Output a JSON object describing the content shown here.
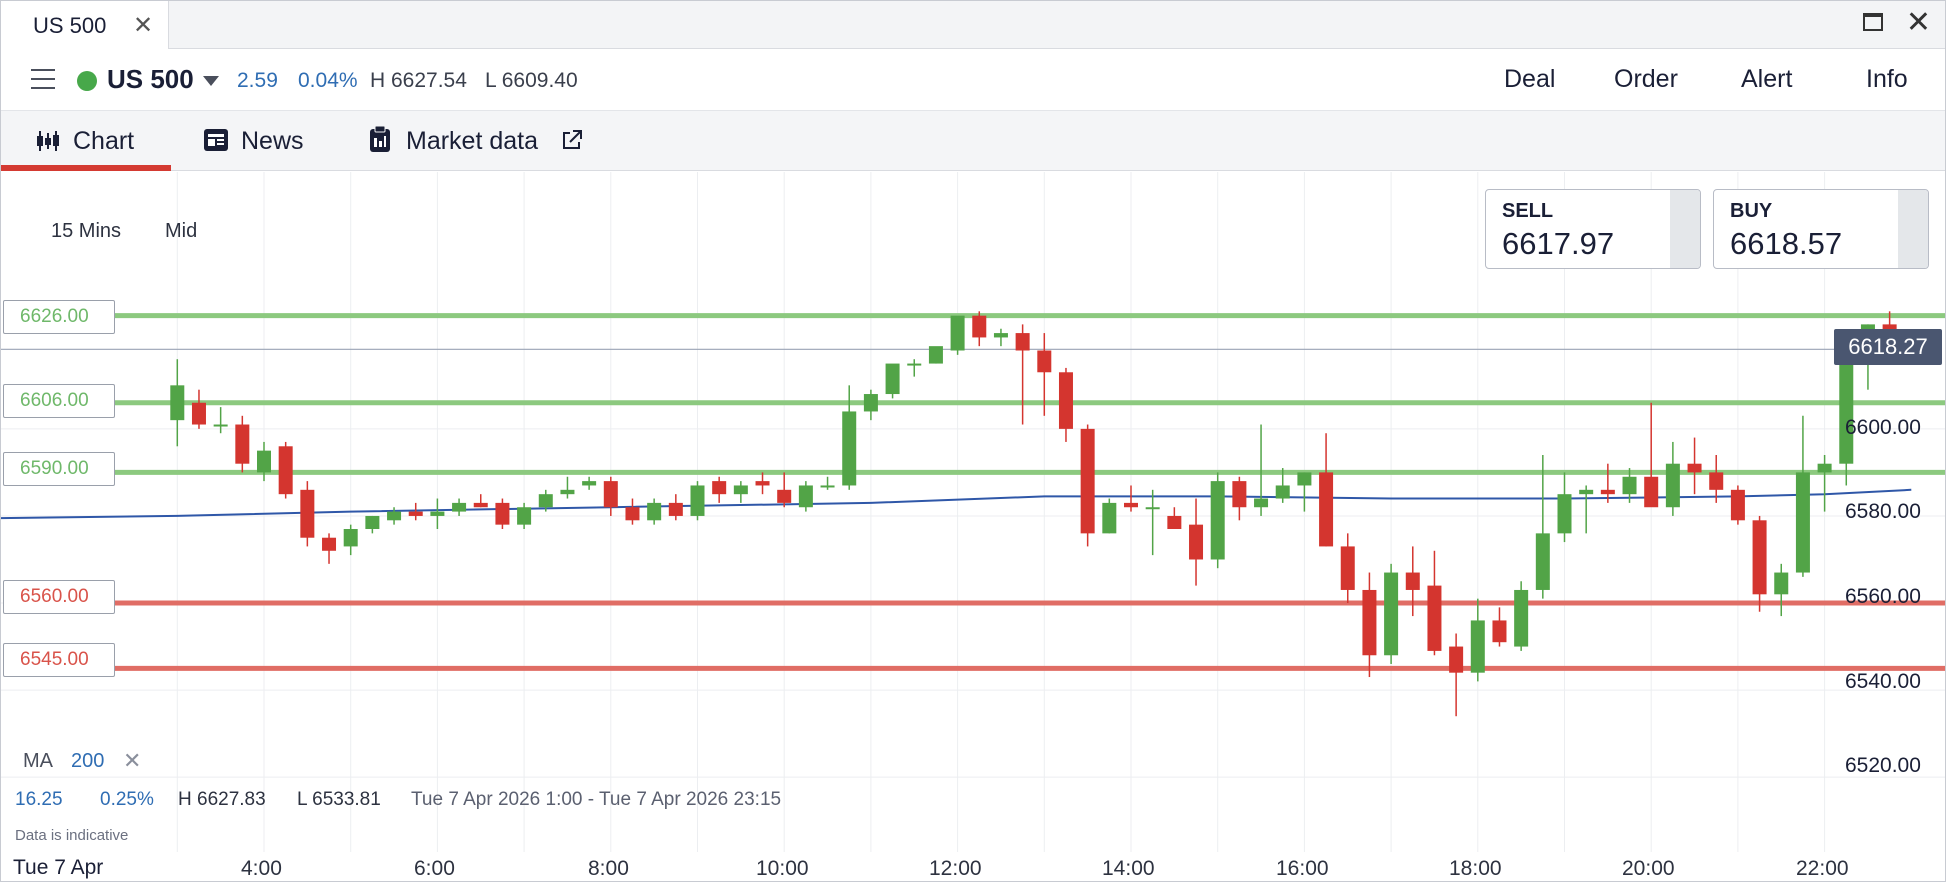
{
  "window": {
    "tab_title": "US 500",
    "close_glyph": "✕",
    "maximize_icon": "maximize-icon",
    "close_icon": "close-icon"
  },
  "instrument": {
    "name": "US 500",
    "status_color": "#47a84a",
    "change": "2.59",
    "change_pct": "0.04%",
    "high": "H 6627.54",
    "low": "L 6609.40"
  },
  "header_actions": [
    "Deal",
    "Order",
    "Alert",
    "Info"
  ],
  "tabs": [
    {
      "label": "Chart",
      "icon": "candlestick-icon",
      "active": true
    },
    {
      "label": "News",
      "icon": "newspaper-icon",
      "active": false
    },
    {
      "label": "Market data",
      "icon": "clipboard-icon",
      "external_icon": "external-link-icon",
      "active": false
    }
  ],
  "chart_controls": {
    "timeframe": "15 Mins",
    "price_type": "Mid"
  },
  "quotes": {
    "sell": {
      "label": "SELL",
      "value": "6617.97"
    },
    "buy": {
      "label": "BUY",
      "value": "6618.57"
    }
  },
  "current_price": "6618.27",
  "levels": [
    {
      "label": "6626.00",
      "value": 6626,
      "color": "#8cc97f"
    },
    {
      "label": "6606.00",
      "value": 6606,
      "color": "#8cc97f"
    },
    {
      "label": "6590.00",
      "value": 6590,
      "color": "#8cc97f"
    },
    {
      "label": "6560.00",
      "value": 6560,
      "color": "#e06d65"
    },
    {
      "label": "6545.00",
      "value": 6545,
      "color": "#e06d65"
    }
  ],
  "indicator": {
    "name": "MA",
    "period": "200",
    "remove_glyph": "✕"
  },
  "stats": {
    "change": "16.25",
    "change_pct": "0.25%",
    "high": "H 6627.83",
    "low": "L 6533.81",
    "range": "Tue 7 Apr 2026 1:00 - Tue 7 Apr 2026 23:15"
  },
  "disclaimer": "Data is indicative",
  "date_label": "Tue 7 Apr",
  "chart_data": {
    "type": "candlestick",
    "timeframe": "15 Mins",
    "y_ticks": [
      "6600.00",
      "6580.00",
      "6560.00",
      "6540.00",
      "6520.00"
    ],
    "x_ticks": [
      "4:00",
      "6:00",
      "8:00",
      "10:00",
      "12:00",
      "14:00",
      "16:00",
      "18:00",
      "20:00",
      "22:00"
    ],
    "ylim": [
      6512,
      6659
    ],
    "xlim": [
      "3:00",
      "23:15"
    ],
    "colors": {
      "up": "#52a447",
      "down": "#d4352f",
      "ma": "#2f57a8"
    },
    "candles": [
      {
        "t": "3:00",
        "o": 6602,
        "h": 6616,
        "l": 6596,
        "c": 6610
      },
      {
        "t": "3:15",
        "o": 6606,
        "h": 6609,
        "l": 6600,
        "c": 6601
      },
      {
        "t": "3:30",
        "o": 6601,
        "h": 6605,
        "l": 6599,
        "c": 6601
      },
      {
        "t": "3:45",
        "o": 6601,
        "h": 6603,
        "l": 6590,
        "c": 6592
      },
      {
        "t": "4:00",
        "o": 6590,
        "h": 6597,
        "l": 6588,
        "c": 6595
      },
      {
        "t": "4:15",
        "o": 6596,
        "h": 6597,
        "l": 6584,
        "c": 6585
      },
      {
        "t": "4:30",
        "o": 6586,
        "h": 6588,
        "l": 6573,
        "c": 6575
      },
      {
        "t": "4:45",
        "o": 6575,
        "h": 6576,
        "l": 6569,
        "c": 6572
      },
      {
        "t": "5:00",
        "o": 6573,
        "h": 6578,
        "l": 6571,
        "c": 6577
      },
      {
        "t": "5:15",
        "o": 6577,
        "h": 6580,
        "l": 6576,
        "c": 6580
      },
      {
        "t": "5:30",
        "o": 6579,
        "h": 6582,
        "l": 6578,
        "c": 6581
      },
      {
        "t": "5:45",
        "o": 6581,
        "h": 6583,
        "l": 6579,
        "c": 6580
      },
      {
        "t": "6:00",
        "o": 6580,
        "h": 6584,
        "l": 6577,
        "c": 6581
      },
      {
        "t": "6:15",
        "o": 6581,
        "h": 6584,
        "l": 6580,
        "c": 6583
      },
      {
        "t": "6:30",
        "o": 6583,
        "h": 6585,
        "l": 6582,
        "c": 6582
      },
      {
        "t": "6:45",
        "o": 6583,
        "h": 6584,
        "l": 6577,
        "c": 6578
      },
      {
        "t": "7:00",
        "o": 6578,
        "h": 6583,
        "l": 6577,
        "c": 6582
      },
      {
        "t": "7:15",
        "o": 6582,
        "h": 6586,
        "l": 6581,
        "c": 6585
      },
      {
        "t": "7:30",
        "o": 6585,
        "h": 6589,
        "l": 6584,
        "c": 6586
      },
      {
        "t": "7:45",
        "o": 6587,
        "h": 6589,
        "l": 6586,
        "c": 6588
      },
      {
        "t": "8:00",
        "o": 6588,
        "h": 6589,
        "l": 6580,
        "c": 6582
      },
      {
        "t": "8:15",
        "o": 6582,
        "h": 6584,
        "l": 6578,
        "c": 6579
      },
      {
        "t": "8:30",
        "o": 6579,
        "h": 6584,
        "l": 6578,
        "c": 6583
      },
      {
        "t": "8:45",
        "o": 6583,
        "h": 6585,
        "l": 6579,
        "c": 6580
      },
      {
        "t": "9:00",
        "o": 6580,
        "h": 6588,
        "l": 6579,
        "c": 6587
      },
      {
        "t": "9:15",
        "o": 6588,
        "h": 6589,
        "l": 6583,
        "c": 6585
      },
      {
        "t": "9:30",
        "o": 6585,
        "h": 6588,
        "l": 6583,
        "c": 6587
      },
      {
        "t": "9:45",
        "o": 6588,
        "h": 6590,
        "l": 6585,
        "c": 6587
      },
      {
        "t": "10:00",
        "o": 6586,
        "h": 6590,
        "l": 6582,
        "c": 6583
      },
      {
        "t": "10:15",
        "o": 6582,
        "h": 6588,
        "l": 6581,
        "c": 6587
      },
      {
        "t": "10:30",
        "o": 6587,
        "h": 6589,
        "l": 6586,
        "c": 6587
      },
      {
        "t": "10:45",
        "o": 6587,
        "h": 6610,
        "l": 6586,
        "c": 6604
      },
      {
        "t": "11:00",
        "o": 6604,
        "h": 6609,
        "l": 6602,
        "c": 6608
      },
      {
        "t": "11:15",
        "o": 6608,
        "h": 6612,
        "l": 6607,
        "c": 6615
      },
      {
        "t": "11:30",
        "o": 6615,
        "h": 6616,
        "l": 6612,
        "c": 6615
      },
      {
        "t": "11:45",
        "o": 6615,
        "h": 6618,
        "l": 6615,
        "c": 6619
      },
      {
        "t": "12:00",
        "o": 6618,
        "h": 6623,
        "l": 6617,
        "c": 6626
      },
      {
        "t": "12:15",
        "o": 6626,
        "h": 6627,
        "l": 6619,
        "c": 6621
      },
      {
        "t": "12:30",
        "o": 6621,
        "h": 6623,
        "l": 6619,
        "c": 6622
      },
      {
        "t": "12:45",
        "o": 6622,
        "h": 6624,
        "l": 6601,
        "c": 6618
      },
      {
        "t": "13:00",
        "o": 6618,
        "h": 6622,
        "l": 6603,
        "c": 6613
      },
      {
        "t": "13:15",
        "o": 6613,
        "h": 6614,
        "l": 6597,
        "c": 6600
      },
      {
        "t": "13:30",
        "o": 6600,
        "h": 6601,
        "l": 6573,
        "c": 6576
      },
      {
        "t": "13:45",
        "o": 6576,
        "h": 6584,
        "l": 6576,
        "c": 6583
      },
      {
        "t": "14:00",
        "o": 6583,
        "h": 6587,
        "l": 6581,
        "c": 6582
      },
      {
        "t": "14:15",
        "o": 6582,
        "h": 6586,
        "l": 6571,
        "c": 6582
      },
      {
        "t": "14:30",
        "o": 6580,
        "h": 6582,
        "l": 6577,
        "c": 6577
      },
      {
        "t": "14:45",
        "o": 6578,
        "h": 6584,
        "l": 6564,
        "c": 6570
      },
      {
        "t": "15:00",
        "o": 6570,
        "h": 6590,
        "l": 6568,
        "c": 6588
      },
      {
        "t": "15:15",
        "o": 6588,
        "h": 6589,
        "l": 6579,
        "c": 6582
      },
      {
        "t": "15:30",
        "o": 6582,
        "h": 6601,
        "l": 6580,
        "c": 6584
      },
      {
        "t": "15:45",
        "o": 6584,
        "h": 6591,
        "l": 6583,
        "c": 6587
      },
      {
        "t": "16:00",
        "o": 6587,
        "h": 6590,
        "l": 6581,
        "c": 6590
      },
      {
        "t": "16:15",
        "o": 6590,
        "h": 6599,
        "l": 6573,
        "c": 6573
      },
      {
        "t": "16:30",
        "o": 6573,
        "h": 6576,
        "l": 6560,
        "c": 6563
      },
      {
        "t": "16:45",
        "o": 6563,
        "h": 6567,
        "l": 6543,
        "c": 6548
      },
      {
        "t": "17:00",
        "o": 6548,
        "h": 6569,
        "l": 6546,
        "c": 6567
      },
      {
        "t": "17:15",
        "o": 6567,
        "h": 6573,
        "l": 6557,
        "c": 6563
      },
      {
        "t": "17:30",
        "o": 6564,
        "h": 6572,
        "l": 6548,
        "c": 6549
      },
      {
        "t": "17:45",
        "o": 6550,
        "h": 6553,
        "l": 6534,
        "c": 6544
      },
      {
        "t": "18:00",
        "o": 6544,
        "h": 6561,
        "l": 6542,
        "c": 6556
      },
      {
        "t": "18:15",
        "o": 6556,
        "h": 6559,
        "l": 6550,
        "c": 6551
      },
      {
        "t": "18:30",
        "o": 6550,
        "h": 6565,
        "l": 6549,
        "c": 6563
      },
      {
        "t": "18:45",
        "o": 6563,
        "h": 6594,
        "l": 6561,
        "c": 6576
      },
      {
        "t": "19:00",
        "o": 6576,
        "h": 6590,
        "l": 6574,
        "c": 6585
      },
      {
        "t": "19:15",
        "o": 6585,
        "h": 6587,
        "l": 6576,
        "c": 6586
      },
      {
        "t": "19:30",
        "o": 6586,
        "h": 6592,
        "l": 6583,
        "c": 6585
      },
      {
        "t": "19:45",
        "o": 6585,
        "h": 6591,
        "l": 6583,
        "c": 6589
      },
      {
        "t": "20:00",
        "o": 6589,
        "h": 6606,
        "l": 6584,
        "c": 6582
      },
      {
        "t": "20:15",
        "o": 6582,
        "h": 6597,
        "l": 6580,
        "c": 6592
      },
      {
        "t": "20:30",
        "o": 6592,
        "h": 6598,
        "l": 6585,
        "c": 6590
      },
      {
        "t": "20:45",
        "o": 6590,
        "h": 6594,
        "l": 6583,
        "c": 6586
      },
      {
        "t": "21:00",
        "o": 6586,
        "h": 6587,
        "l": 6578,
        "c": 6579
      },
      {
        "t": "21:15",
        "o": 6579,
        "h": 6580,
        "l": 6558,
        "c": 6562
      },
      {
        "t": "21:30",
        "o": 6562,
        "h": 6569,
        "l": 6557,
        "c": 6567
      },
      {
        "t": "21:45",
        "o": 6567,
        "h": 6603,
        "l": 6566,
        "c": 6590
      },
      {
        "t": "22:00",
        "o": 6590,
        "h": 6594,
        "l": 6581,
        "c": 6592
      },
      {
        "t": "22:15",
        "o": 6592,
        "h": 6616,
        "l": 6587,
        "c": 6616
      },
      {
        "t": "22:30",
        "o": 6616,
        "h": 6624,
        "l": 6609,
        "c": 6624
      },
      {
        "t": "22:45",
        "o": 6624,
        "h": 6627,
        "l": 6617,
        "c": 6618
      }
    ],
    "ma_200": [
      {
        "t": "3:00",
        "v": 6580
      },
      {
        "t": "5:00",
        "v": 6581
      },
      {
        "t": "8:00",
        "v": 6582
      },
      {
        "t": "11:00",
        "v": 6583
      },
      {
        "t": "13:00",
        "v": 6584.5
      },
      {
        "t": "15:00",
        "v": 6584.5
      },
      {
        "t": "17:00",
        "v": 6584
      },
      {
        "t": "19:00",
        "v": 6584
      },
      {
        "t": "21:00",
        "v": 6584.5
      },
      {
        "t": "22:00",
        "v": 6585
      },
      {
        "t": "23:00",
        "v": 6586
      }
    ]
  }
}
